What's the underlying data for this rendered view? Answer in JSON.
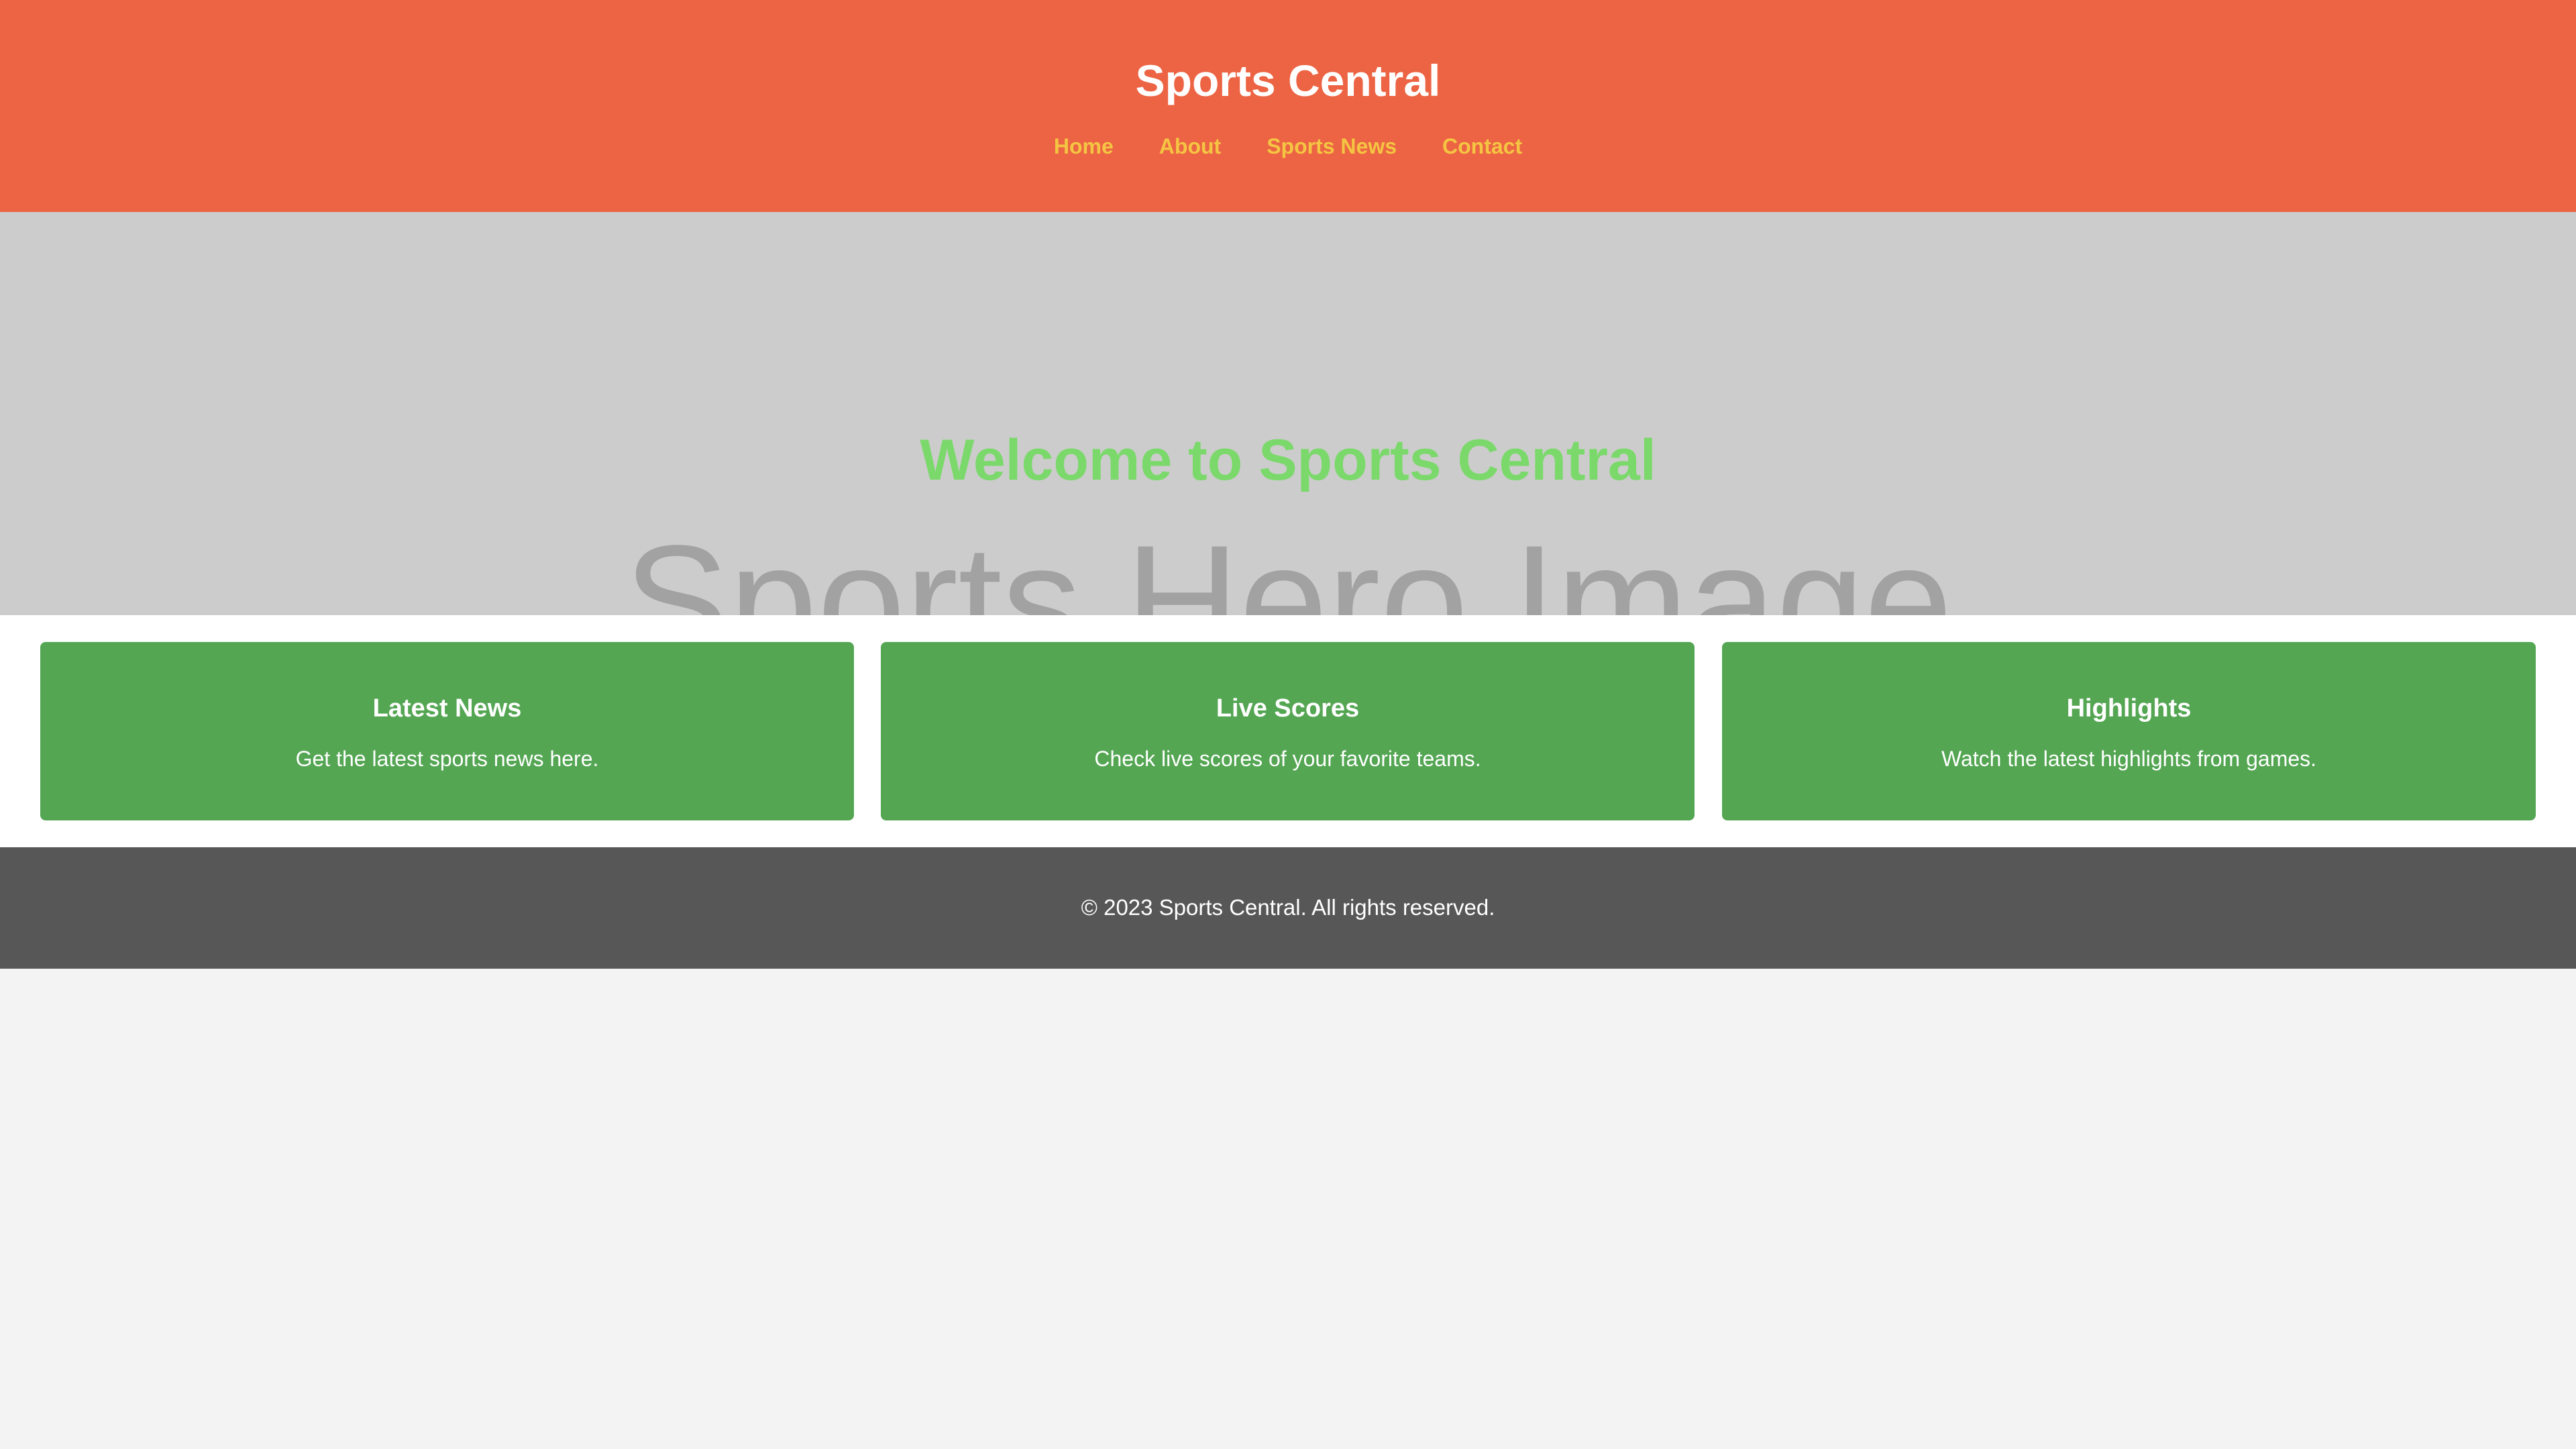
{
  "header": {
    "title": "Sports Central",
    "nav": [
      {
        "label": "Home"
      },
      {
        "label": "About"
      },
      {
        "label": "Sports News"
      },
      {
        "label": "Contact"
      }
    ]
  },
  "hero": {
    "heading": "Welcome to Sports Central",
    "image_alt": "Sports Hero Image"
  },
  "features": [
    {
      "title": "Latest News",
      "description": "Get the latest sports news here."
    },
    {
      "title": "Live Scores",
      "description": "Check live scores of your favorite teams."
    },
    {
      "title": "Highlights",
      "description": "Watch the latest highlights from games."
    }
  ],
  "footer": {
    "text": "© 2023 Sports Central. All rights reserved."
  },
  "colors": {
    "header_bg": "#ec6443",
    "nav_link": "#f4c542",
    "hero_bg": "#cccccc",
    "hero_heading": "#7bd96b",
    "card_bg": "#54a653",
    "footer_bg": "#575757",
    "page_bg": "#f3f3f3"
  }
}
